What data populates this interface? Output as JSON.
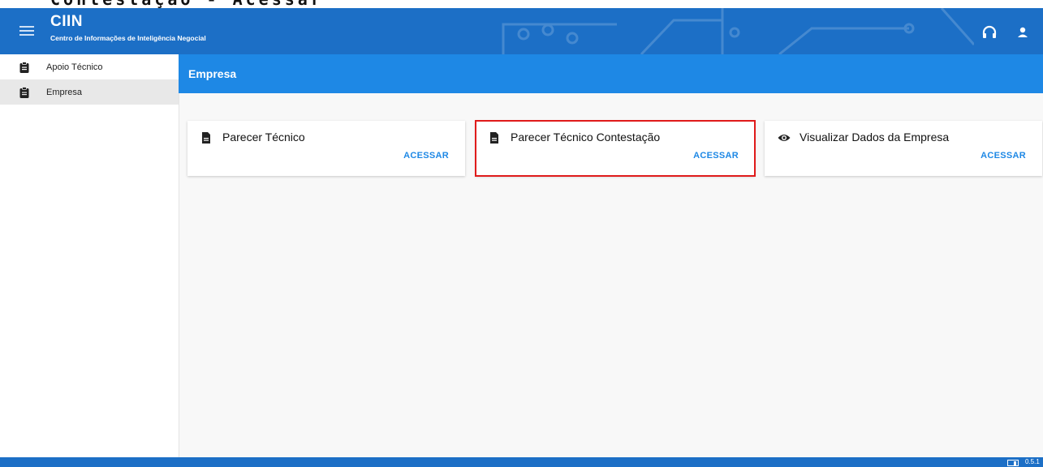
{
  "page_top": {
    "clipped_text": "Contestação - Acessar"
  },
  "header": {
    "title": "CIIN",
    "subtitle": "Centro de Informações de Inteligência Negocial"
  },
  "sidebar": {
    "items": [
      {
        "label": "Apoio Técnico",
        "active": false
      },
      {
        "label": "Empresa",
        "active": true
      }
    ]
  },
  "section": {
    "title": "Empresa"
  },
  "cards": [
    {
      "title": "Parecer Técnico",
      "action": "ACESSAR",
      "icon": "document-icon"
    },
    {
      "title": "Parecer Técnico Contestação",
      "action": "ACESSAR",
      "icon": "document-icon",
      "highlighted": true
    },
    {
      "title": "Visualizar Dados da Empresa",
      "action": "ACESSAR",
      "icon": "eye-icon"
    }
  ],
  "footer": {
    "version": "0.5.1"
  },
  "colors": {
    "appbar": "#1c6fc6",
    "section": "#1e88e5",
    "accent": "#1e88e5",
    "highlight": "#e01b1b"
  }
}
